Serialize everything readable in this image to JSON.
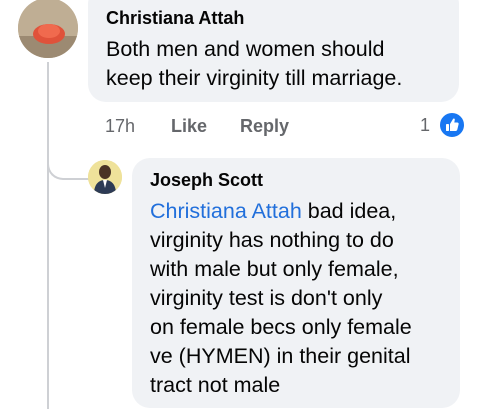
{
  "comments": [
    {
      "author": "Christiana Attah",
      "text_lines": [
        "Both men and women should",
        "keep their virginity till marriage."
      ],
      "time": "17h",
      "actions": [
        "Like",
        "Reply"
      ],
      "reaction_count": "1",
      "reaction_icon": "like-thumb-icon",
      "colors": {
        "bubble": "#f0f2f5",
        "like_badge": "#1877f2"
      }
    }
  ],
  "reply": {
    "author": "Joseph Scott",
    "mention": "Christiana Attah",
    "text_lines": [
      " bad idea,",
      "virginity has nothing to do",
      "with male but only female,",
      "virginity test is don't only",
      "on female becs only female",
      "ve (HYMEN) in their genital",
      "tract not male"
    ],
    "colors": {
      "mention": "#216fdb"
    }
  }
}
